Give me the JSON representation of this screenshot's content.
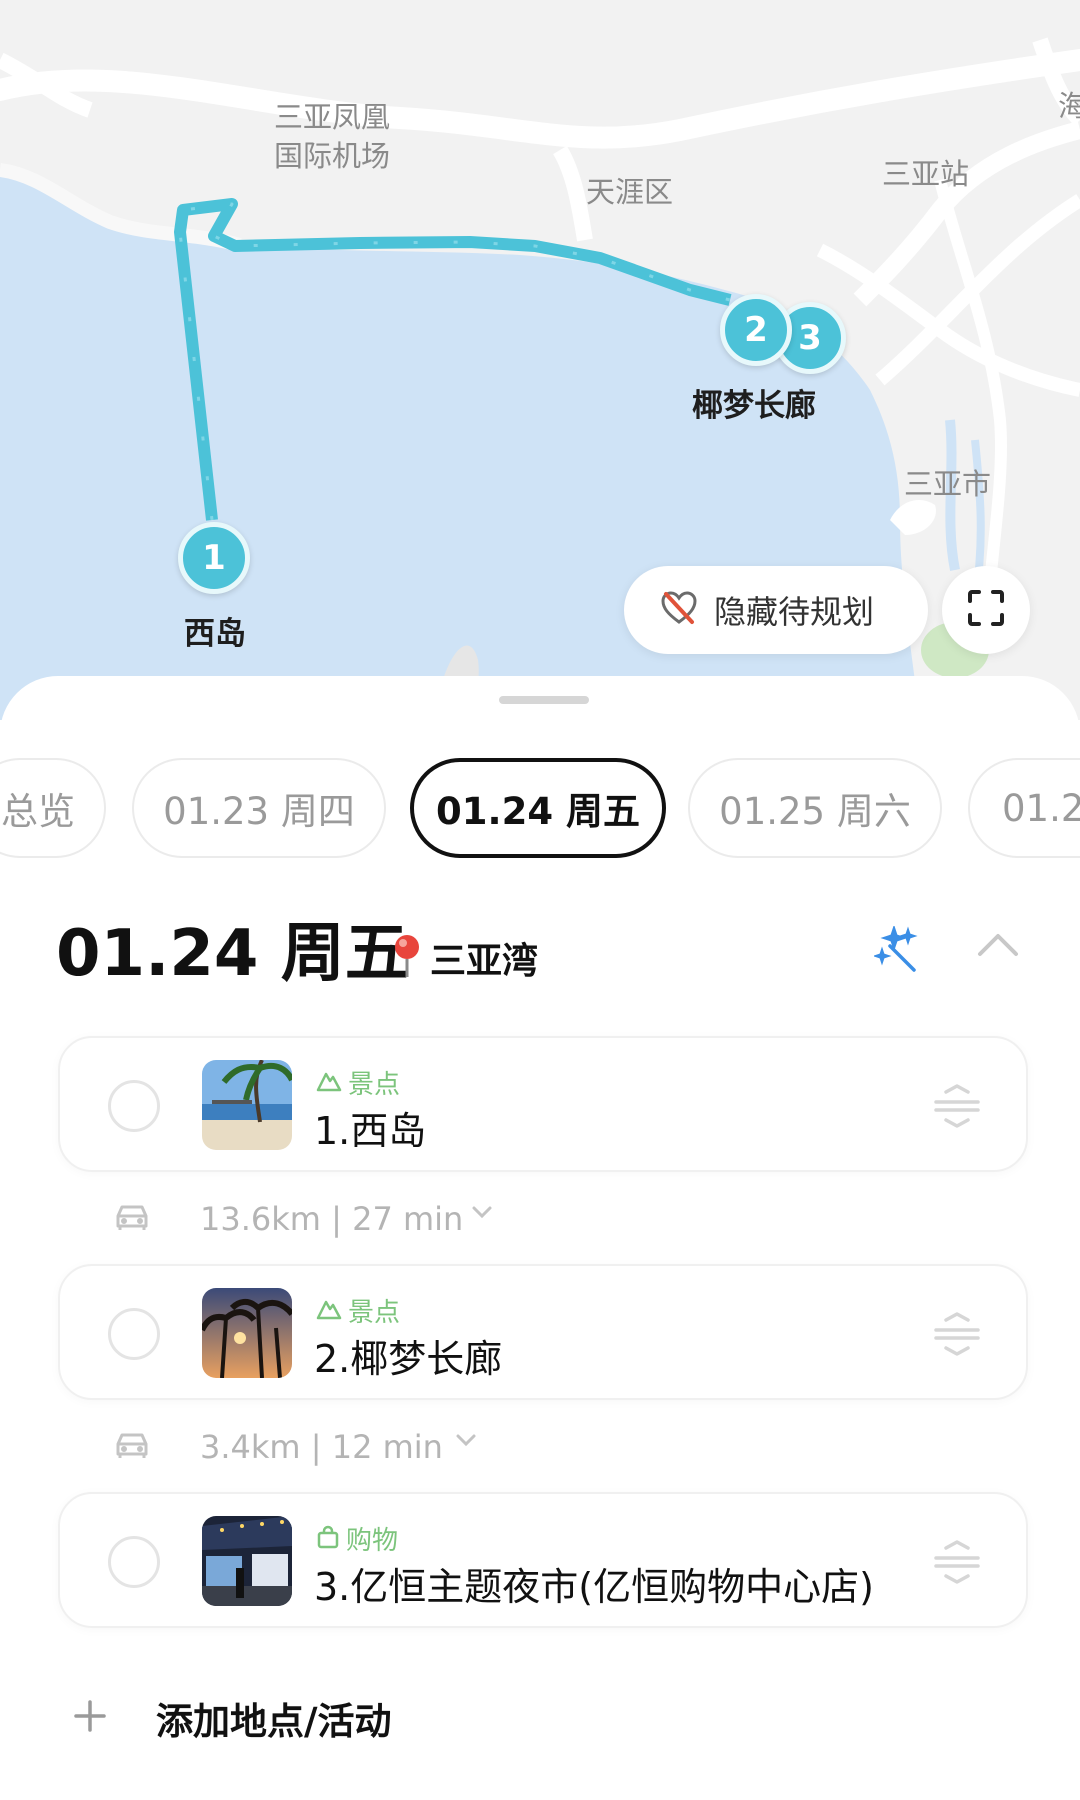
{
  "map": {
    "labels": {
      "airport_line1": "三亚凤凰",
      "airport_line2": "国际机场",
      "tianya": "天涯区",
      "sanya_station": "三亚站",
      "sanya_city": "三亚市",
      "hai": "海"
    },
    "places": {
      "xidao": "西岛",
      "yemeng": "椰梦长廊"
    },
    "pins": [
      "1",
      "2",
      "3"
    ],
    "hide_button_label": "隐藏待规划",
    "colors": {
      "water": "#cfe3f6",
      "land": "#f2f2f2",
      "route": "#4cc2d8"
    }
  },
  "tabs": [
    {
      "label": "总览",
      "active": false
    },
    {
      "label": "01.23 周四",
      "active": false
    },
    {
      "label": "01.24 周五",
      "active": true
    },
    {
      "label": "01.25 周六",
      "active": false
    },
    {
      "label": "01.2",
      "active": false
    }
  ],
  "day": {
    "title": "01.24 周五",
    "location": "三亚湾"
  },
  "items": [
    {
      "category": "景点",
      "category_icon": "mountain-icon",
      "name": "1.西岛"
    },
    {
      "category": "景点",
      "category_icon": "mountain-icon",
      "name": "2.椰梦长廊"
    },
    {
      "category": "购物",
      "category_icon": "shopping-bag-icon",
      "name": "3.亿恒主题夜市(亿恒购物中心店)"
    }
  ],
  "transits": [
    {
      "text": "13.6km | 27 min",
      "mode_icon": "car-icon"
    },
    {
      "text": "3.4km | 12 min",
      "mode_icon": "car-icon"
    }
  ],
  "add_label": "添加地点/活动"
}
